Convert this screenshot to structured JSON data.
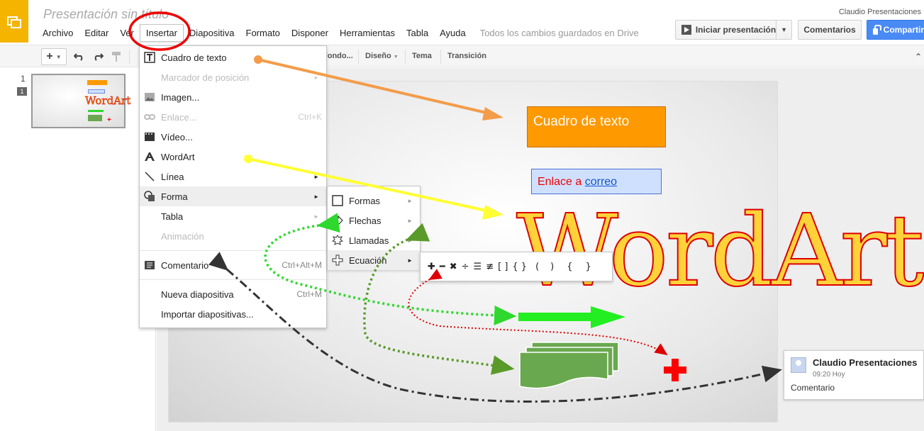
{
  "doc": {
    "title": "Presentación sin título"
  },
  "menubar": {
    "items": [
      "Archivo",
      "Editar",
      "Ver",
      "Insertar",
      "Diapositiva",
      "Formato",
      "Disponer",
      "Herramientas",
      "Tabla",
      "Ayuda"
    ],
    "active": "Insertar",
    "save_status": "Todos los cambios guardados en Drive"
  },
  "header": {
    "user": "Claudio Presentaciones",
    "present_label": "Iniciar presentación",
    "comments_label": "Comentarios",
    "share_label": "Compartir"
  },
  "toolbar": {
    "fondo": "Fondo...",
    "diseno": "Diseño",
    "tema": "Tema",
    "transicion": "Transición"
  },
  "slides": {
    "number": "1",
    "badge": "1"
  },
  "insert_menu": {
    "items": [
      {
        "label": "Cuadro de texto",
        "icon": "text-box-icon",
        "enabled": true
      },
      {
        "label": "Marcador de posición",
        "icon": "",
        "enabled": false,
        "submenu": true
      },
      {
        "label": "Imagen...",
        "icon": "image-icon",
        "enabled": true
      },
      {
        "label": "Enlace...",
        "icon": "link-icon",
        "enabled": false,
        "shortcut": "Ctrl+K"
      },
      {
        "label": "Vídeo...",
        "icon": "video-icon",
        "enabled": true
      },
      {
        "label": "WordArt",
        "icon": "wordart-icon",
        "enabled": true
      },
      {
        "label": "Línea",
        "icon": "line-icon",
        "enabled": true,
        "submenu": true
      },
      {
        "label": "Forma",
        "icon": "shape-icon",
        "enabled": true,
        "submenu": true,
        "highlighted": true
      },
      {
        "label": "Tabla",
        "icon": "",
        "enabled": true,
        "submenu": true
      },
      {
        "label": "Animación",
        "icon": "",
        "enabled": false
      },
      {
        "label": "Comentario",
        "icon": "comment-icon",
        "enabled": true,
        "shortcut": "Ctrl+Alt+M"
      },
      {
        "label": "Nueva diapositiva",
        "icon": "",
        "enabled": true,
        "shortcut": "Ctrl+M"
      },
      {
        "label": "Importar diapositivas...",
        "icon": "",
        "enabled": true
      }
    ]
  },
  "shape_submenu": {
    "items": [
      {
        "label": "Formas",
        "icon": "square-icon"
      },
      {
        "label": "Flechas",
        "icon": "arrow-icon"
      },
      {
        "label": "Llamadas",
        "icon": "callout-icon"
      },
      {
        "label": "Ecuación",
        "icon": "plus-icon",
        "highlighted": true
      }
    ]
  },
  "equation_symbols": [
    "✚",
    "━",
    "✖",
    "÷",
    "☰",
    "≢",
    "[ ]",
    "{ }",
    "(",
    ")",
    "{",
    "}"
  ],
  "slide_content": {
    "textbox": "Cuadro de texto",
    "link_prefix": "Enlace a ",
    "link_text": "correo",
    "wordart": "WordArt"
  },
  "comment": {
    "author": "Claudio Presentaciones",
    "time": "09:20 Hoy",
    "text": "Comentario"
  },
  "colors": {
    "logo": "#f4b400",
    "share": "#4a8af4",
    "orange_box": "#ff9900",
    "wordart_fill": "#ffd23a",
    "wordart_stroke": "#dd0000"
  }
}
